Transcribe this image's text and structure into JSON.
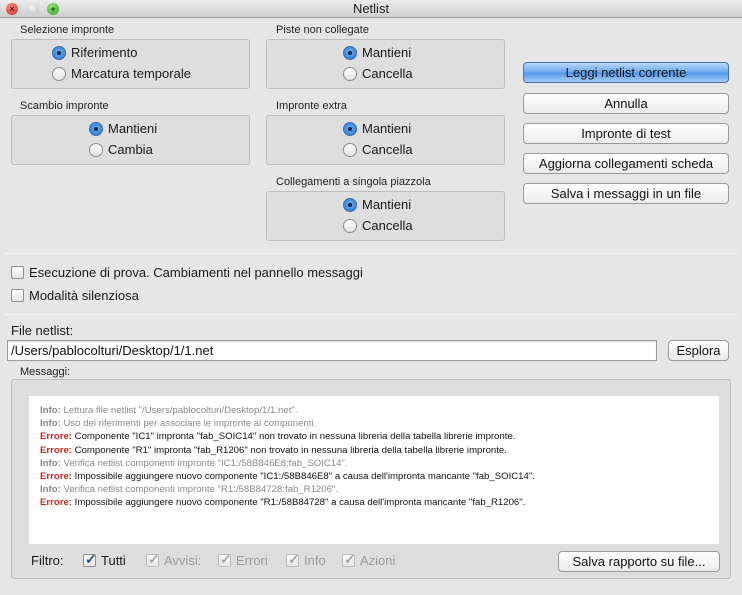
{
  "window": {
    "title": "Netlist"
  },
  "groups": {
    "footprint_selection": {
      "label": "Selezione impronte",
      "options": [
        "Riferimento",
        "Marcatura temporale"
      ],
      "selected": "Riferimento"
    },
    "footprint_swap": {
      "label": "Scambio impronte",
      "options": [
        "Mantieni",
        "Cambia"
      ],
      "selected": "Mantieni"
    },
    "unconnected_tracks": {
      "label": "Piste non collegate",
      "options": [
        "Mantieni",
        "Cancella"
      ],
      "selected": "Mantieni"
    },
    "extra_footprints": {
      "label": "Impronte extra",
      "options": [
        "Mantieni",
        "Cancella"
      ],
      "selected": "Mantieni"
    },
    "single_pad_nets": {
      "label": "Collegamenti a singola piazzola",
      "options": [
        "Mantieni",
        "Cancella"
      ],
      "selected": "Mantieni"
    }
  },
  "buttons": {
    "read_netlist": "Leggi netlist corrente",
    "cancel": "Annulla",
    "test_footprints": "Impronte di test",
    "update_board": "Aggiorna collegamenti scheda",
    "save_messages": "Salva i messaggi in un file",
    "browse": "Esplora",
    "save_report": "Salva rapporto su file..."
  },
  "options": {
    "dry_run": {
      "label": "Esecuzione di prova. Cambiamenti nel pannello messaggi",
      "checked": false
    },
    "silent_mode": {
      "label": "Modalità silenziosa",
      "checked": false
    }
  },
  "netlist_file": {
    "label": "File netlist:",
    "value": "/Users/pablocolturi/Desktop/1/1.net"
  },
  "messages": {
    "label": "Messaggi:",
    "lines": [
      {
        "level": "info",
        "tag": "Info:",
        "text": " Lettura file netlist \"/Users/pablocolturi/Desktop/1/1.net\"."
      },
      {
        "level": "info",
        "tag": "Info:",
        "text": " Uso dei riferimenti per associare le impronte ai componenti."
      },
      {
        "level": "error",
        "tag": "Errore:",
        "text": " Componente \"IC1\" impronta \"fab_SOIC14\" non trovato in nessuna libreria della tabella librerie impronte."
      },
      {
        "level": "error",
        "tag": "Errore:",
        "text": " Componente \"R1\" impronta \"fab_R1206\" non trovato in nessuna libreria della tabella librerie impronte."
      },
      {
        "level": "info",
        "tag": "Info:",
        "text": " Verifica netlist componenti impronte \"IC1:/58B846E8:fab_SOIC14\"."
      },
      {
        "level": "error",
        "tag": "Errore:",
        "text": " Impossibile aggiungere nuovo componente \"IC1:/58B846E8\" a causa dell'impronta mancante \"fab_SOIC14\"."
      },
      {
        "level": "info",
        "tag": "Info:",
        "text": " Verifica netlist componenti impronte \"R1:/58B84728:fab_R1206\"."
      },
      {
        "level": "error",
        "tag": "Errore:",
        "text": " Impossibile aggiungere nuovo componente \"R1:/58B84728\" a causa dell'impronta mancante \"fab_R1206\"."
      }
    ]
  },
  "filter": {
    "label": "Filtro:",
    "items": [
      {
        "label": "Tutti",
        "checked": true,
        "enabled": true
      },
      {
        "label": "Avvisi:",
        "checked": true,
        "enabled": false
      },
      {
        "label": "Errori",
        "checked": true,
        "enabled": false
      },
      {
        "label": "Info",
        "checked": true,
        "enabled": false
      },
      {
        "label": "Azioni",
        "checked": true,
        "enabled": false
      }
    ]
  },
  "colors": {
    "error_tag": "#d0281c",
    "info_text": "#8a8a8a",
    "default_button": "#4f95ea"
  }
}
